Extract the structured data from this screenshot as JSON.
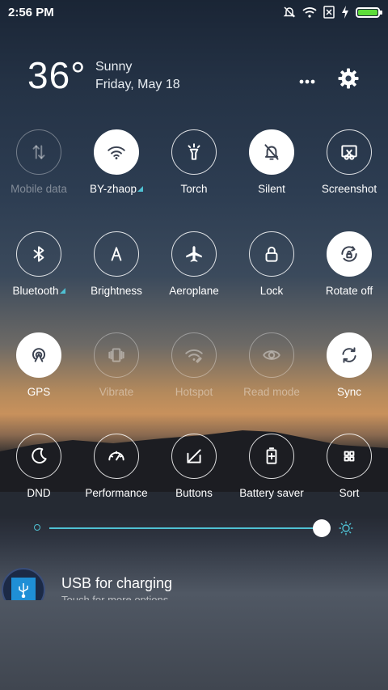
{
  "status": {
    "time": "2:56 PM",
    "battery_level": 1.0,
    "battery_color": "#5ddc3a"
  },
  "weather": {
    "temperature": "36°",
    "condition": "Sunny",
    "date": "Friday, May 18"
  },
  "toggles": [
    {
      "label": "Mobile data",
      "icon": "mobile-data-icon",
      "state": "disabled"
    },
    {
      "label": "BY-zhaop",
      "icon": "wifi-icon",
      "state": "on",
      "expand": true
    },
    {
      "label": "Torch",
      "icon": "torch-icon",
      "state": "off"
    },
    {
      "label": "Silent",
      "icon": "bell-off-icon",
      "state": "on"
    },
    {
      "label": "Screenshot",
      "icon": "screenshot-icon",
      "state": "off"
    },
    {
      "label": "Bluetooth",
      "icon": "bluetooth-icon",
      "state": "off",
      "expand": true
    },
    {
      "label": "Brightness",
      "icon": "brightness-auto-icon",
      "state": "off"
    },
    {
      "label": "Aeroplane",
      "icon": "airplane-icon",
      "state": "off"
    },
    {
      "label": "Lock",
      "icon": "lock-icon",
      "state": "off"
    },
    {
      "label": "Rotate off",
      "icon": "rotate-lock-icon",
      "state": "on"
    },
    {
      "label": "GPS",
      "icon": "gps-icon",
      "state": "on"
    },
    {
      "label": "Vibrate",
      "icon": "vibrate-icon",
      "state": "disabled"
    },
    {
      "label": "Hotspot",
      "icon": "hotspot-icon",
      "state": "disabled"
    },
    {
      "label": "Read mode",
      "icon": "eye-icon",
      "state": "disabled"
    },
    {
      "label": "Sync",
      "icon": "sync-icon",
      "state": "on"
    },
    {
      "label": "DND",
      "icon": "moon-icon",
      "state": "off"
    },
    {
      "label": "Performance",
      "icon": "speedometer-icon",
      "state": "off"
    },
    {
      "label": "Buttons",
      "icon": "buttons-icon",
      "state": "off"
    },
    {
      "label": "Battery saver",
      "icon": "battery-saver-icon",
      "state": "off"
    },
    {
      "label": "Sort",
      "icon": "grid-icon",
      "state": "off"
    }
  ],
  "brightness": {
    "level": 0.96,
    "accent": "#4fc1d3"
  },
  "notification": {
    "title": "USB for charging",
    "subtitle": "Touch for more options",
    "icon": "usb-icon"
  }
}
